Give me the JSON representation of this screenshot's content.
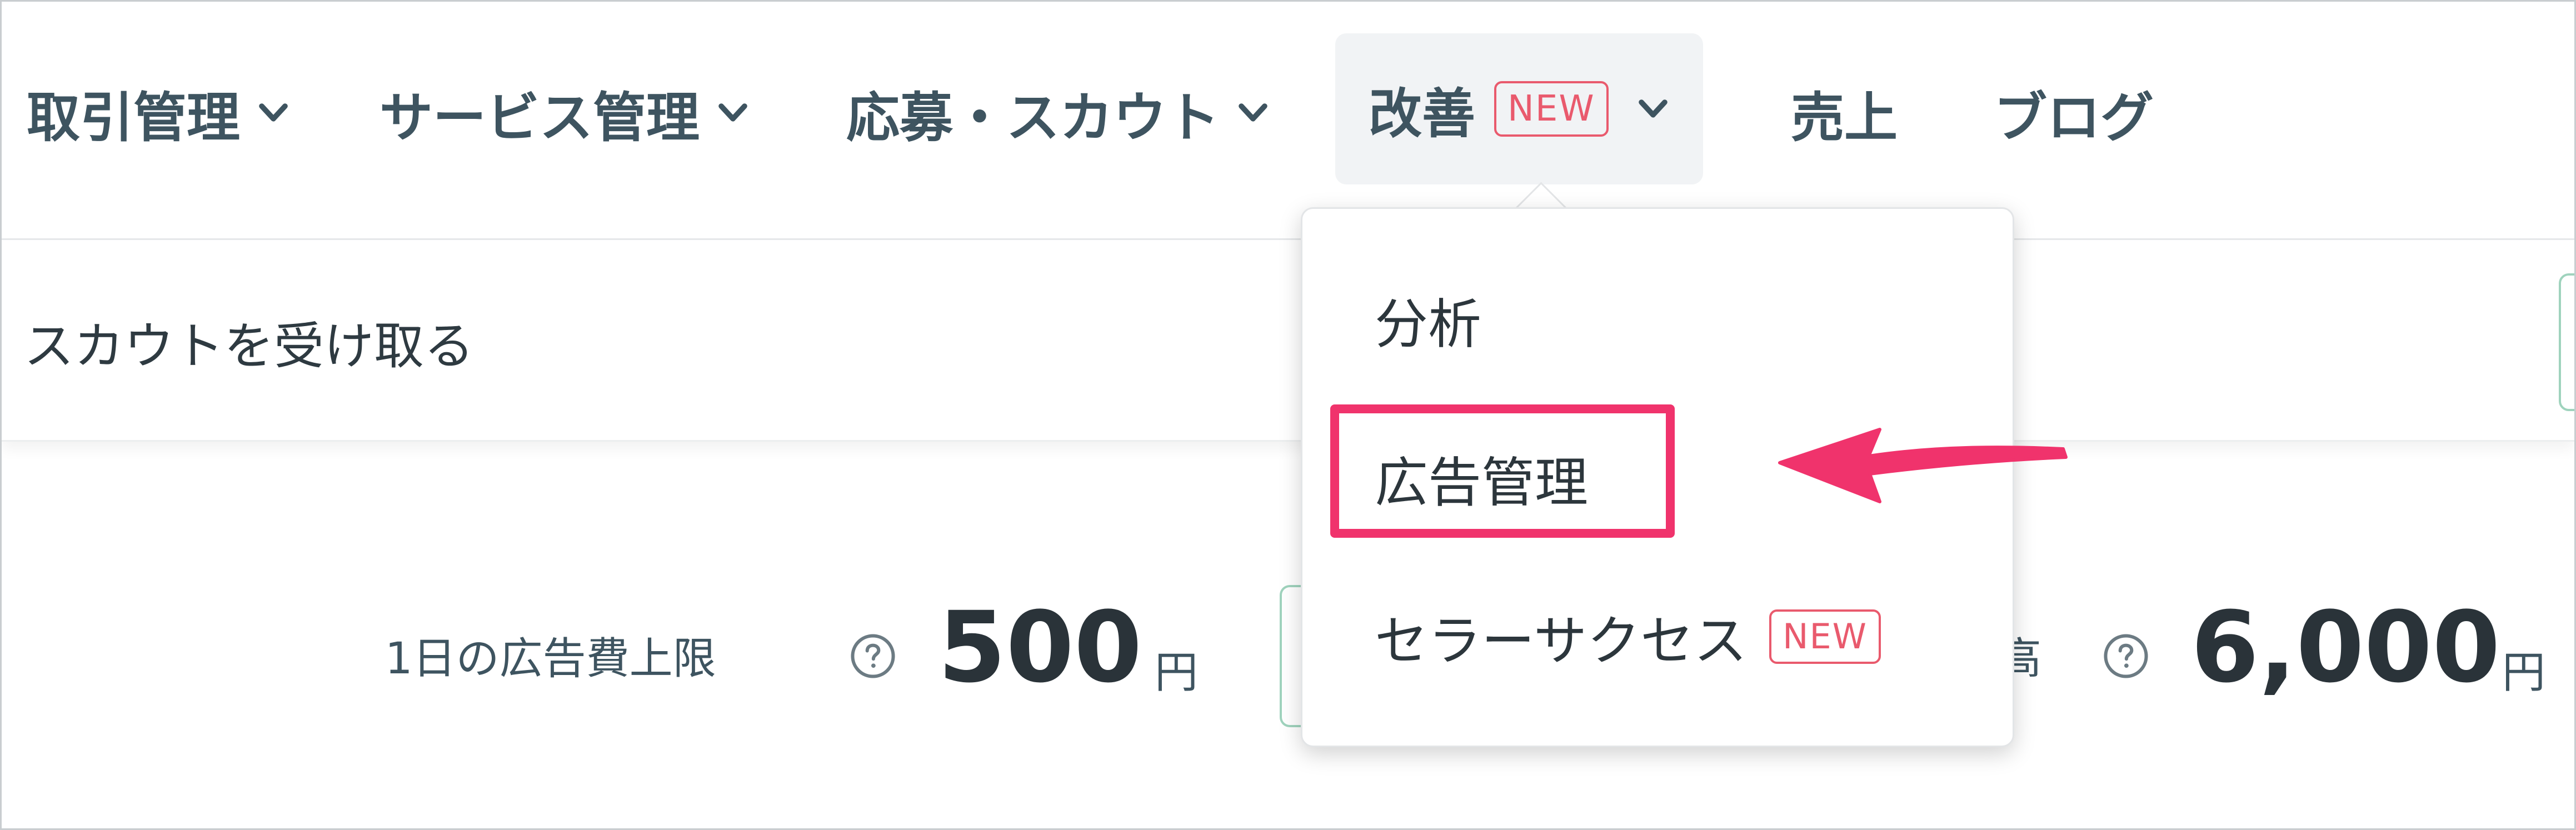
{
  "nav": {
    "items": [
      {
        "label": "取引管理",
        "has_dropdown": true
      },
      {
        "label": "サービス管理",
        "has_dropdown": true
      },
      {
        "label": "応募・スカウト",
        "has_dropdown": true
      },
      {
        "label": "改善",
        "badge": "NEW",
        "has_dropdown": true,
        "active": true
      },
      {
        "label": "売上"
      },
      {
        "label": "ブログ"
      }
    ]
  },
  "subbar": {
    "text": "スカウトを受け取る"
  },
  "stats": {
    "daily_limit_label": "1日の広告費上限",
    "daily_limit_value": "500",
    "daily_limit_unit": "円",
    "balance_label": "残高",
    "balance_value": "6,000",
    "balance_unit": "円"
  },
  "dropdown": {
    "items": [
      {
        "label": "分析"
      },
      {
        "label": "広告管理",
        "highlighted": true
      },
      {
        "label": "セラーサクセス",
        "badge": "NEW"
      }
    ]
  },
  "colors": {
    "accent_pink": "#f0336c",
    "badge_red": "#e95a6d",
    "nav_text": "#3e5460",
    "green_outline": "#9fd3bd"
  }
}
